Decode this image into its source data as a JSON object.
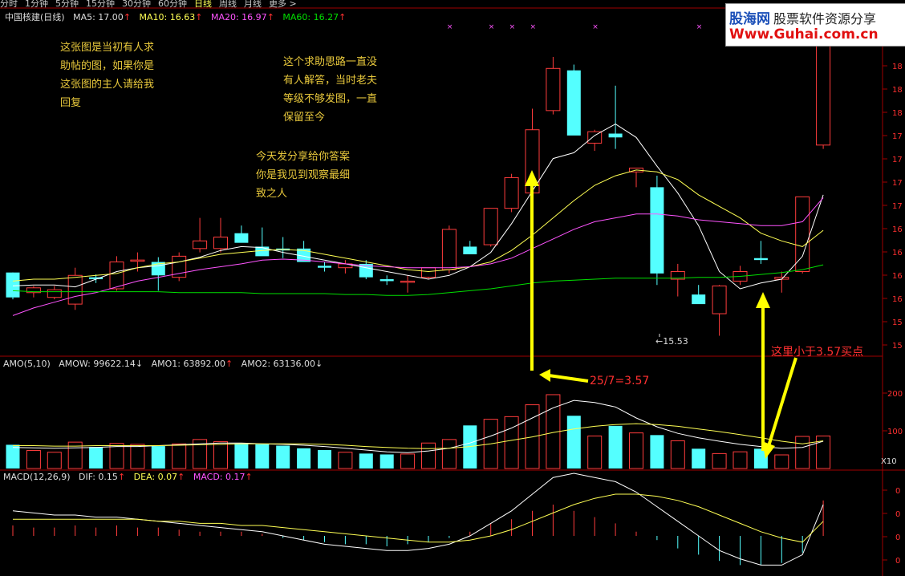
{
  "toolbar": {
    "periods": [
      "分时",
      "1分钟",
      "5分钟",
      "15分钟",
      "30分钟",
      "60分钟",
      "日线",
      "周线",
      "月线",
      "更多 >"
    ],
    "active_period": "日线"
  },
  "logo": {
    "line1_a": "股海网",
    "line1_b": "股票软件资源分享",
    "line2": "Www.Guhai.com.cn"
  },
  "main_panel": {
    "title": "中国核建(日线)",
    "ma5": "MA5: 17.00",
    "ma10": "MA10: 16.63",
    "ma20": "MA20: 16.97",
    "ma60": "MA60: 16.27",
    "low_label": "←15.53",
    "y_ticks": [
      "18",
      "18",
      "18",
      "17",
      "17",
      "17",
      "17",
      "16",
      "16",
      "16",
      "16",
      "15",
      "15"
    ]
  },
  "amo_panel": {
    "title": "AMO(5,10)",
    "amow": "AMOW: 99622.14",
    "amo1": "AMO1: 63892.00",
    "amo2": "AMO2: 63136.00",
    "y_ticks": [
      "200",
      "100"
    ],
    "unit": "X10"
  },
  "macd_panel": {
    "title": "MACD(12,26,9)",
    "dif": "DIF: 0.15",
    "dea": "DEA: 0.07",
    "macd": "MACD: 0.17",
    "y_ticks": [
      "0",
      "0",
      "0",
      "0"
    ]
  },
  "annotations": {
    "note1": [
      "这张图是当初有人求",
      "助帖的图，如果你是",
      "这张图的主人请给我",
      "回复"
    ],
    "note2": [
      "这个求助思路一直没",
      "有人解答，当时老夫",
      "等级不够发图，一直",
      "保留至今"
    ],
    "note3": [
      "今天发分享给你答案",
      "你是我见到观察最细",
      "致之人"
    ],
    "ratio": "25/7=3.57",
    "buy_point": "这里小于3.57买点"
  },
  "colors": {
    "up": "#ff3c3c",
    "down": "#54ffff",
    "ma5": "#ffffff",
    "ma10": "#ffff54",
    "ma20": "#ff54ff",
    "ma60": "#00e000",
    "arrow": "#ffff00"
  },
  "chart_data": {
    "type": "candlestick",
    "candles_ohlc": [
      [
        16.19,
        16.19,
        15.91,
        15.93
      ],
      [
        15.98,
        16.05,
        15.93,
        16.03
      ],
      [
        15.93,
        16.05,
        15.91,
        16.01
      ],
      [
        15.86,
        16.24,
        15.8,
        16.16
      ],
      [
        16.14,
        16.17,
        16.08,
        16.12
      ],
      [
        16.02,
        16.36,
        16.0,
        16.3
      ],
      [
        16.32,
        16.4,
        16.2,
        16.32
      ],
      [
        16.3,
        16.35,
        16.0,
        16.16
      ],
      [
        16.14,
        16.4,
        16.1,
        16.36
      ],
      [
        16.44,
        16.76,
        16.4,
        16.52
      ],
      [
        16.44,
        16.76,
        16.4,
        16.56
      ],
      [
        16.6,
        16.68,
        16.52,
        16.5
      ],
      [
        16.46,
        16.66,
        16.42,
        16.36
      ],
      [
        16.44,
        16.56,
        16.34,
        16.42
      ],
      [
        16.44,
        16.52,
        16.38,
        16.3
      ],
      [
        16.26,
        16.3,
        16.2,
        16.24
      ],
      [
        16.24,
        16.32,
        16.18,
        16.28
      ],
      [
        16.28,
        16.32,
        16.12,
        16.14
      ],
      [
        16.12,
        16.16,
        16.06,
        16.1
      ],
      [
        16.1,
        16.16,
        15.98,
        16.1
      ],
      [
        16.14,
        16.24,
        16.12,
        16.24
      ],
      [
        16.22,
        16.68,
        16.18,
        16.64
      ],
      [
        16.46,
        16.52,
        16.4,
        16.38
      ],
      [
        16.48,
        16.86,
        16.46,
        16.86
      ],
      [
        16.86,
        17.22,
        16.82,
        17.18
      ],
      [
        17.02,
        17.9,
        17.0,
        17.68
      ],
      [
        17.88,
        18.44,
        17.84,
        18.32
      ],
      [
        18.3,
        18.36,
        17.76,
        17.62
      ],
      [
        17.54,
        17.68,
        17.46,
        17.66
      ],
      [
        17.64,
        18.14,
        17.48,
        17.6
      ],
      [
        17.24,
        17.28,
        17.08,
        17.28
      ],
      [
        17.08,
        17.2,
        16.06,
        16.18
      ],
      [
        16.12,
        16.28,
        15.94,
        16.2
      ],
      [
        15.96,
        16.06,
        15.9,
        15.86
      ],
      [
        15.76,
        16.06,
        15.53,
        16.05
      ],
      [
        16.1,
        16.26,
        16.06,
        16.2
      ],
      [
        16.34,
        16.52,
        16.28,
        16.32
      ],
      [
        16.12,
        16.2,
        15.98,
        16.14
      ],
      [
        16.2,
        16.98,
        16.18,
        16.98
      ],
      [
        17.52,
        18.98,
        17.48,
        18.98
      ]
    ],
    "amo_x10": [
      54,
      41,
      37,
      60,
      49,
      57,
      55,
      51,
      56,
      66,
      61,
      57,
      55,
      52,
      46,
      42,
      37,
      34,
      32,
      33,
      58,
      66,
      98,
      112,
      118,
      145,
      168,
      120,
      74,
      97,
      81,
      76,
      63,
      45,
      34,
      38,
      45,
      31,
      73,
      74
    ],
    "macd_hist": [
      0.05,
      0.04,
      0.04,
      0.05,
      0.04,
      0.05,
      0.04,
      0.04,
      0.03,
      0.02,
      0.02,
      0.02,
      0.01,
      -0.01,
      -0.02,
      -0.03,
      -0.04,
      -0.04,
      -0.05,
      -0.04,
      -0.03,
      -0.01,
      0.02,
      0.06,
      0.08,
      0.12,
      0.15,
      0.12,
      0.09,
      0.06,
      0.02,
      -0.02,
      -0.06,
      -0.09,
      -0.12,
      -0.14,
      -0.14,
      -0.13,
      -0.08,
      0.17
    ],
    "series": [
      {
        "name": "MA5",
        "values": [
          16.05,
          16.06,
          16.06,
          16.04,
          16.12,
          16.2,
          16.24,
          16.26,
          16.3,
          16.35,
          16.42,
          16.46,
          16.45,
          16.4,
          16.36,
          16.32,
          16.28,
          16.24,
          16.2,
          16.16,
          16.12,
          16.16,
          16.25,
          16.4,
          16.7,
          17.04,
          17.38,
          17.44,
          17.62,
          17.74,
          17.6,
          17.3,
          17.02,
          16.68,
          16.2,
          16.02,
          16.08,
          16.12,
          16.36,
          17.0
        ]
      },
      {
        "name": "MA10",
        "values": [
          16.1,
          16.12,
          16.12,
          16.14,
          16.16,
          16.18,
          16.24,
          16.28,
          16.3,
          16.34,
          16.38,
          16.4,
          16.42,
          16.43,
          16.42,
          16.38,
          16.34,
          16.3,
          16.26,
          16.22,
          16.2,
          16.22,
          16.25,
          16.3,
          16.42,
          16.58,
          16.76,
          16.94,
          17.1,
          17.2,
          17.26,
          17.24,
          17.16,
          17.0,
          16.88,
          16.76,
          16.6,
          16.52,
          16.46,
          16.63
        ]
      },
      {
        "name": "MA20",
        "values": [
          15.74,
          15.82,
          15.88,
          15.94,
          15.98,
          16.04,
          16.1,
          16.14,
          16.18,
          16.22,
          16.25,
          16.28,
          16.32,
          16.33,
          16.32,
          16.3,
          16.28,
          16.26,
          16.25,
          16.24,
          16.24,
          16.24,
          16.25,
          16.28,
          16.34,
          16.44,
          16.54,
          16.64,
          16.72,
          16.76,
          16.8,
          16.8,
          16.78,
          16.74,
          16.72,
          16.7,
          16.68,
          16.68,
          16.72,
          16.97
        ]
      },
      {
        "name": "MA60",
        "values": [
          16.0,
          15.99,
          15.99,
          15.99,
          15.99,
          15.99,
          15.99,
          15.99,
          15.98,
          15.98,
          15.98,
          15.98,
          15.97,
          15.97,
          15.97,
          15.97,
          15.96,
          15.96,
          15.95,
          15.95,
          15.96,
          15.98,
          16.0,
          16.02,
          16.05,
          16.08,
          16.1,
          16.11,
          16.12,
          16.13,
          16.13,
          16.13,
          16.13,
          16.14,
          16.14,
          16.15,
          16.17,
          16.19,
          16.22,
          16.27
        ]
      }
    ],
    "amo_lines": [
      {
        "name": "AMO1",
        "values": [
          48,
          47,
          46,
          47,
          48,
          50,
          50,
          52,
          54,
          56,
          58,
          58,
          56,
          55,
          53,
          50,
          46,
          42,
          38,
          36,
          40,
          46,
          58,
          74,
          92,
          115,
          138,
          155,
          150,
          140,
          115,
          95,
          80,
          70,
          62,
          55,
          50,
          46,
          48,
          62
        ]
      },
      {
        "name": "AMO2",
        "values": [
          52,
          52,
          51,
          51,
          52,
          52,
          52,
          52,
          53,
          54,
          55,
          56,
          56,
          56,
          56,
          55,
          53,
          50,
          48,
          46,
          45,
          46,
          50,
          56,
          64,
          72,
          82,
          90,
          96,
          100,
          102,
          100,
          96,
          90,
          84,
          77,
          70,
          62,
          56,
          63
        ]
      }
    ],
    "macd_lines": [
      {
        "name": "DIF",
        "values": [
          0.12,
          0.11,
          0.1,
          0.1,
          0.09,
          0.09,
          0.08,
          0.07,
          0.06,
          0.05,
          0.04,
          0.03,
          0.02,
          0.0,
          -0.02,
          -0.04,
          -0.05,
          -0.06,
          -0.07,
          -0.07,
          -0.06,
          -0.04,
          0.0,
          0.06,
          0.12,
          0.2,
          0.28,
          0.3,
          0.28,
          0.26,
          0.21,
          0.14,
          0.07,
          0.0,
          -0.07,
          -0.11,
          -0.14,
          -0.14,
          -0.09,
          0.15
        ]
      },
      {
        "name": "DEA",
        "values": [
          0.08,
          0.08,
          0.08,
          0.08,
          0.08,
          0.08,
          0.08,
          0.07,
          0.07,
          0.06,
          0.06,
          0.05,
          0.05,
          0.04,
          0.03,
          0.02,
          0.01,
          0.0,
          -0.01,
          -0.02,
          -0.03,
          -0.03,
          -0.02,
          0.0,
          0.03,
          0.07,
          0.11,
          0.15,
          0.18,
          0.2,
          0.2,
          0.19,
          0.17,
          0.14,
          0.1,
          0.06,
          0.02,
          -0.01,
          -0.03,
          0.07
        ]
      }
    ]
  }
}
